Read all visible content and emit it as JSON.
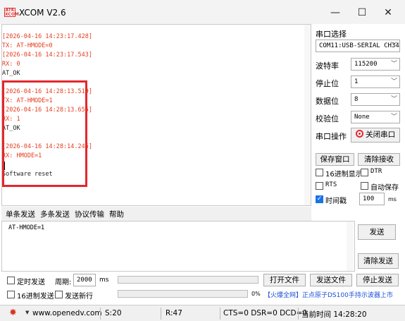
{
  "app": {
    "title": "XCOM V2.6",
    "logo_text": "ATK XCOM"
  },
  "window_controls": {
    "minimize": "—",
    "maximize": "☐",
    "close": "✕"
  },
  "receive": {
    "lines": [
      {
        "text": "[2026-04-16 14:23:17.428]",
        "color": "red"
      },
      {
        "text": "TX: AT-HMODE=0",
        "color": "red"
      },
      {
        "text": "[2026-04-16 14:23:17.543]",
        "color": "red"
      },
      {
        "text": "RX: 0",
        "color": "red"
      },
      {
        "text": "AT_OK",
        "color": "black"
      },
      {
        "text": "",
        "color": "black"
      },
      {
        "text": "[2026-04-16 14:28:13.519]",
        "color": "red"
      },
      {
        "text": "TX: AT-HMODE=1",
        "color": "red"
      },
      {
        "text": "[2026-04-16 14:28:13.655]",
        "color": "red"
      },
      {
        "text": "RX: 1",
        "color": "red"
      },
      {
        "text": "AT_OK",
        "color": "black"
      },
      {
        "text": "",
        "color": "black"
      },
      {
        "text": "[2026-04-16 14:28:14.245]",
        "color": "red"
      },
      {
        "text": "RX: HMODE=1",
        "color": "red"
      },
      {
        "text": "",
        "color": "black"
      },
      {
        "text": "Software reset",
        "color": "black"
      }
    ]
  },
  "settings": {
    "port_label": "串口选择",
    "port_value": "COM11:USB-SERIAL CH34",
    "baud_label": "波特率",
    "baud_value": "115200",
    "stopbits_label": "停止位",
    "stopbits_value": "1",
    "databits_label": "数据位",
    "databits_value": "8",
    "parity_label": "校验位",
    "parity_value": "None",
    "port_op_label": "串口操作",
    "close_port_label": "关闭串口",
    "save_window_label": "保存窗口",
    "clear_recv_label": "清除接收",
    "hex_display_label": "16进制显示",
    "dtr_label": "DTR",
    "rts_label": "RTS",
    "auto_save_label": "自动保存",
    "timestamp_label": "时间戳",
    "timestamp_value": "100",
    "timestamp_unit": "ms",
    "accent": "#e5262d"
  },
  "tabs": [
    "单条发送",
    "多条发送",
    "协议传输",
    "帮助"
  ],
  "send": {
    "text": "AT-HMODE=1",
    "send_label": "发送",
    "clear_send_label": "清除发送"
  },
  "bottom": {
    "timed_send_label": "定时发送",
    "period_label": "周期:",
    "period_value": "2000",
    "period_unit": "ms",
    "open_file_label": "打开文件",
    "send_file_label": "发送文件",
    "stop_send_label": "停止发送",
    "hex_send_label": "16进制发送",
    "send_newline_label": "发送新行",
    "progress_text": "0%",
    "progress_value": 0,
    "ad_text": "【火爆全网】正点原子DS100手持示波器上市"
  },
  "status": {
    "url": "www.openedv.com",
    "s": "S:20",
    "r": "R:47",
    "signals": "CTS=0 DSR=0 DCD=0",
    "time": "当前时间 14:28:20"
  }
}
